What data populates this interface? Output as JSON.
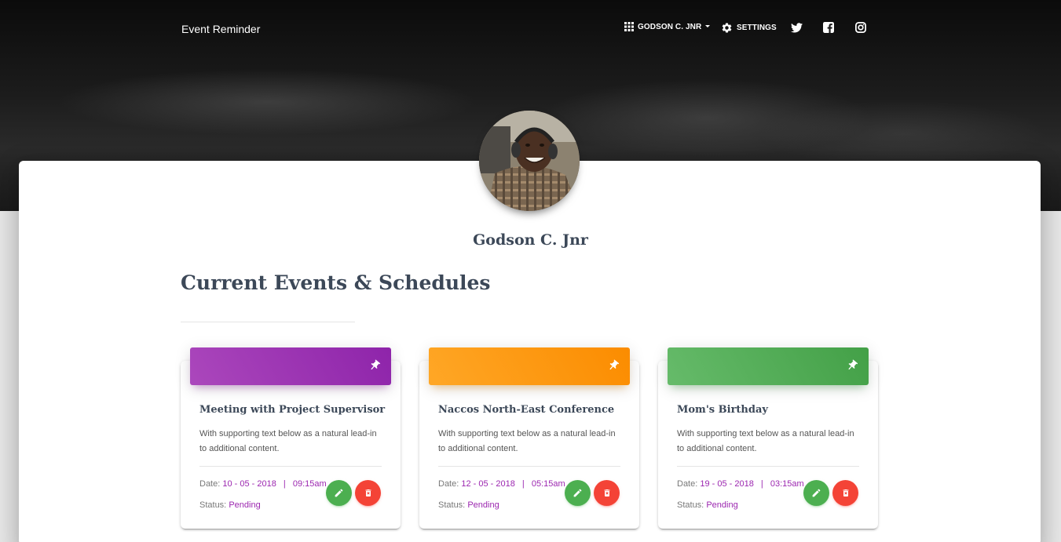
{
  "navbar": {
    "brand": "Event Reminder",
    "user_menu_label": "GODSON C. JNR",
    "settings_label": "SETTINGS",
    "social_icons": [
      "twitter-icon",
      "facebook-icon",
      "instagram-icon"
    ]
  },
  "profile": {
    "name": "Godson C. Jnr"
  },
  "section": {
    "title": "Current Events & Schedules"
  },
  "events": [
    {
      "title": "Meeting with Project Supervisor",
      "description": "With supporting text below as a natural lead-in to additional content.",
      "date_label": "Date:",
      "date": "10 - 05 - 2018",
      "separator": "|",
      "time": "09:15am",
      "status_label": "Status:",
      "status": "Pending",
      "header_color": "#9c27b0"
    },
    {
      "title": "Naccos North-East Conference",
      "description": "With supporting text below as a natural lead-in to additional content.",
      "date_label": "Date:",
      "date": "12 - 05 - 2018",
      "separator": "|",
      "time": "05:15am",
      "status_label": "Status:",
      "status": "Pending",
      "header_color": "#fb8c00"
    },
    {
      "title": "Mom's Birthday",
      "description": "With supporting text below as a natural lead-in to additional content.",
      "date_label": "Date:",
      "date": "19 - 05 - 2018",
      "separator": "|",
      "time": "03:15am",
      "status_label": "Status:",
      "status": "Pending",
      "header_color": "#43a047"
    }
  ],
  "colors": {
    "accent": "#9c27b0",
    "edit_button": "#4caf50",
    "delete_button": "#f44336",
    "text": "#3c4858"
  }
}
